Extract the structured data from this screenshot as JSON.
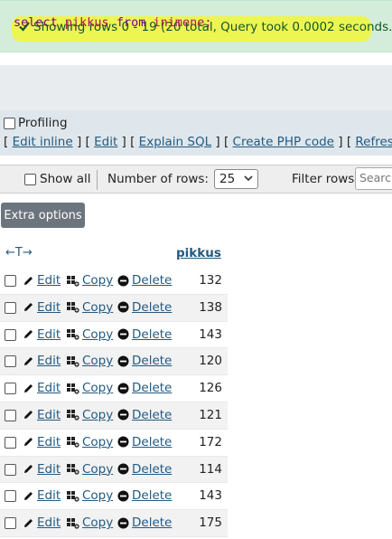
{
  "status": {
    "message": "Showing rows 0 - 19 (20 total, Query took 0.0002 seconds.)",
    "color": "#155724",
    "highlight_color": "#f0f542"
  },
  "sql": {
    "keyword_select": "select",
    "column": "pikkus",
    "keyword_from": "from",
    "table": "inimene;"
  },
  "profiling": {
    "label": "Profiling"
  },
  "sql_links": {
    "edit_inline": "Edit inline",
    "edit": "Edit",
    "explain_sql": "Explain SQL",
    "create_php": "Create PHP code",
    "refresh": "Refresh"
  },
  "navigation": {
    "show_all_label": "Show all",
    "number_of_rows_label": "Number of rows:",
    "number_of_rows_value": "25",
    "filter_label": "Filter rows:",
    "filter_placeholder": "Search this table"
  },
  "extra_options_label": "Extra options",
  "table": {
    "arrows": "←T→",
    "column_header": "pikkus",
    "action_labels": {
      "edit": "Edit",
      "copy": "Copy",
      "delete": "Delete"
    },
    "rows": [
      {
        "value": "132"
      },
      {
        "value": "138"
      },
      {
        "value": "143"
      },
      {
        "value": "120"
      },
      {
        "value": "126"
      },
      {
        "value": "121"
      },
      {
        "value": "172"
      },
      {
        "value": "114"
      },
      {
        "value": "143"
      },
      {
        "value": "175"
      }
    ]
  },
  "colors": {
    "link": "#235a81",
    "sql_keyword": "#770088",
    "sql_token": "#aa1155",
    "button_bg": "#6c757d"
  }
}
